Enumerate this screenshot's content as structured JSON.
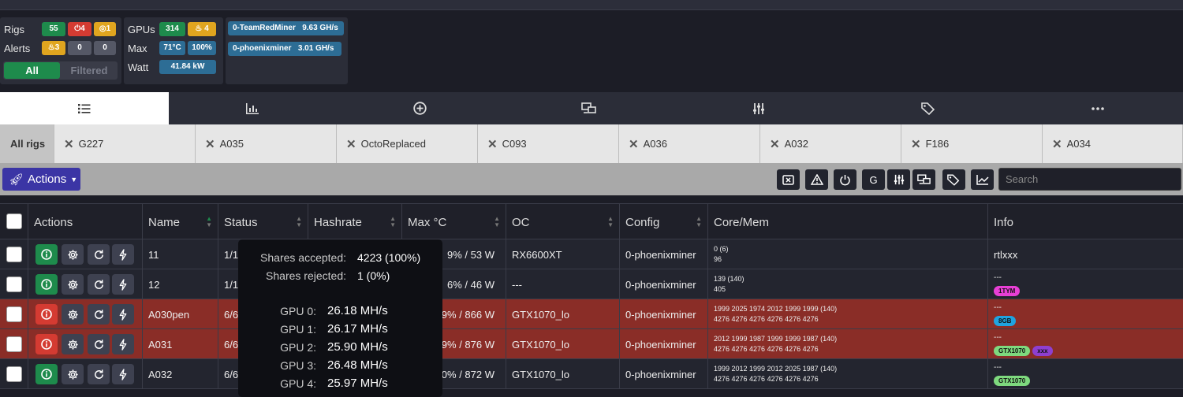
{
  "summary": {
    "rigs_label": "Rigs",
    "alerts_label": "Alerts",
    "rigs": {
      "online": "55",
      "offline": "4",
      "warn": "1"
    },
    "alerts": {
      "overheat": "3",
      "a": "0",
      "b": "0"
    },
    "filter": {
      "all": "All",
      "filtered": "Filtered"
    },
    "gpus_label": "GPUs",
    "max_label": "Max",
    "watt_label": "Watt",
    "gpus": {
      "count": "314",
      "hot": "4"
    },
    "max": {
      "temp": "71°C",
      "fan": "100%"
    },
    "watt": "41.84 kW",
    "miners": [
      {
        "name": "0-TeamRedMiner",
        "rate": "9.63 GH/s"
      },
      {
        "name": "0-phoenixminer",
        "rate": "3.01 GH/s"
      }
    ]
  },
  "nav_icons": [
    "list-icon",
    "chart-icon",
    "plus-circle-icon",
    "transfer-icon",
    "sliders-icon",
    "tags-icon",
    "more-icon"
  ],
  "rig_tabs": [
    "All rigs",
    "G227",
    "A035",
    "OctoReplaced",
    "C093",
    "A036",
    "A032",
    "F186",
    "A034"
  ],
  "toolbar": {
    "actions_label": "Actions",
    "g_label": "G",
    "search_placeholder": "Search"
  },
  "table": {
    "headers": [
      "Actions",
      "Name",
      "Status",
      "Hashrate",
      "Max °C",
      "OC",
      "Config",
      "Core/Mem",
      "Info"
    ],
    "rows": [
      {
        "name": "11",
        "status": "1/1",
        "maxc": "9% / 53 W",
        "oc": "RX6600XT",
        "config": "0-phoenixminer",
        "core": "0 (6)",
        "mem": "96",
        "info": "rtlxxx",
        "tags": [],
        "alert": false
      },
      {
        "name": "12",
        "status": "1/1",
        "maxc": "6% / 46 W",
        "oc": "---",
        "config": "0-phoenixminer",
        "core": "139 (140)",
        "mem": "405",
        "info": "---",
        "tags": [
          {
            "text": "1TYM",
            "color": "#e83fd6"
          }
        ],
        "alert": false
      },
      {
        "name": "A030pen",
        "status": "6/6",
        "maxc": "9% / 866 W",
        "oc": "GTX1070_lo",
        "config": "0-phoenixminer",
        "core": "1999 2025 1974 2012 1999 1999 (140)",
        "mem": "4276 4276 4276 4276 4276 4276",
        "info": "---",
        "tags": [
          {
            "text": "8GB",
            "color": "#1fa3e0"
          }
        ],
        "alert": true
      },
      {
        "name": "A031",
        "status": "6/6",
        "maxc": "9% / 876 W",
        "oc": "GTX1070_lo",
        "config": "0-phoenixminer",
        "core": "2012 1999 1987 1999 1999 1987 (140)",
        "mem": "4276 4276 4276 4276 4276 4276",
        "info": "---",
        "tags": [
          {
            "text": "GTX1070",
            "color": "#7ed97e"
          },
          {
            "text": "xxx",
            "color": "#8e3fd0"
          }
        ],
        "alert": true
      },
      {
        "name": "A032",
        "status": "6/6",
        "maxc": "0% / 872 W",
        "oc": "GTX1070_lo",
        "config": "0-phoenixminer",
        "core": "1999 2012 1999 2012 2025 1987 (140)",
        "mem": "4276 4276 4276 4276 4276 4276",
        "info": "---",
        "tags": [
          {
            "text": "GTX1070",
            "color": "#7ed97e"
          }
        ],
        "alert": false
      }
    ]
  },
  "tooltip": {
    "accepted_label": "Shares accepted:",
    "accepted_value": "4223 (100%)",
    "rejected_label": "Shares rejected:",
    "rejected_value": "1 (0%)",
    "gpus": [
      {
        "label": "GPU 0:",
        "value": "26.18 MH/s"
      },
      {
        "label": "GPU 1:",
        "value": "26.17 MH/s"
      },
      {
        "label": "GPU 2:",
        "value": "25.90 MH/s"
      },
      {
        "label": "GPU 3:",
        "value": "26.48 MH/s"
      },
      {
        "label": "GPU 4:",
        "value": "25.97 MH/s"
      }
    ]
  }
}
